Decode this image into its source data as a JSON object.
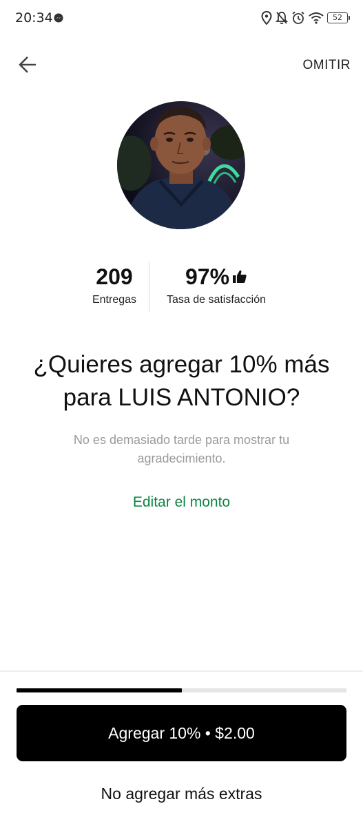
{
  "status_bar": {
    "time": "20:34",
    "battery": "52",
    "icons": [
      "messenger-icon",
      "location-icon",
      "notifications-off-icon",
      "alarm-icon",
      "wifi-icon",
      "battery-icon"
    ]
  },
  "nav": {
    "back_icon": "arrow-left-icon",
    "skip_label": "OMITIR"
  },
  "courier": {
    "avatar": "courier-photo"
  },
  "stats": {
    "deliveries_value": "209",
    "deliveries_label": "Entregas",
    "satisfaction_value": "97%",
    "satisfaction_icon": "thumbs-up-icon",
    "satisfaction_label": "Tasa de satisfacción"
  },
  "question": {
    "title": "¿Quieres agregar 10% más para LUIS ANTONIO?",
    "subtitle": "No es demasiado tarde para mostrar tu agradecimiento.",
    "edit_link": "Editar el monto"
  },
  "progress": {
    "fraction": 0.5
  },
  "actions": {
    "primary_label": "Agregar 10% • $2.00",
    "secondary_label": "No agregar más extras"
  },
  "colors": {
    "accent_green": "#0e8345",
    "primary_button_bg": "#000000",
    "subtitle_gray": "#9a9a9a"
  }
}
